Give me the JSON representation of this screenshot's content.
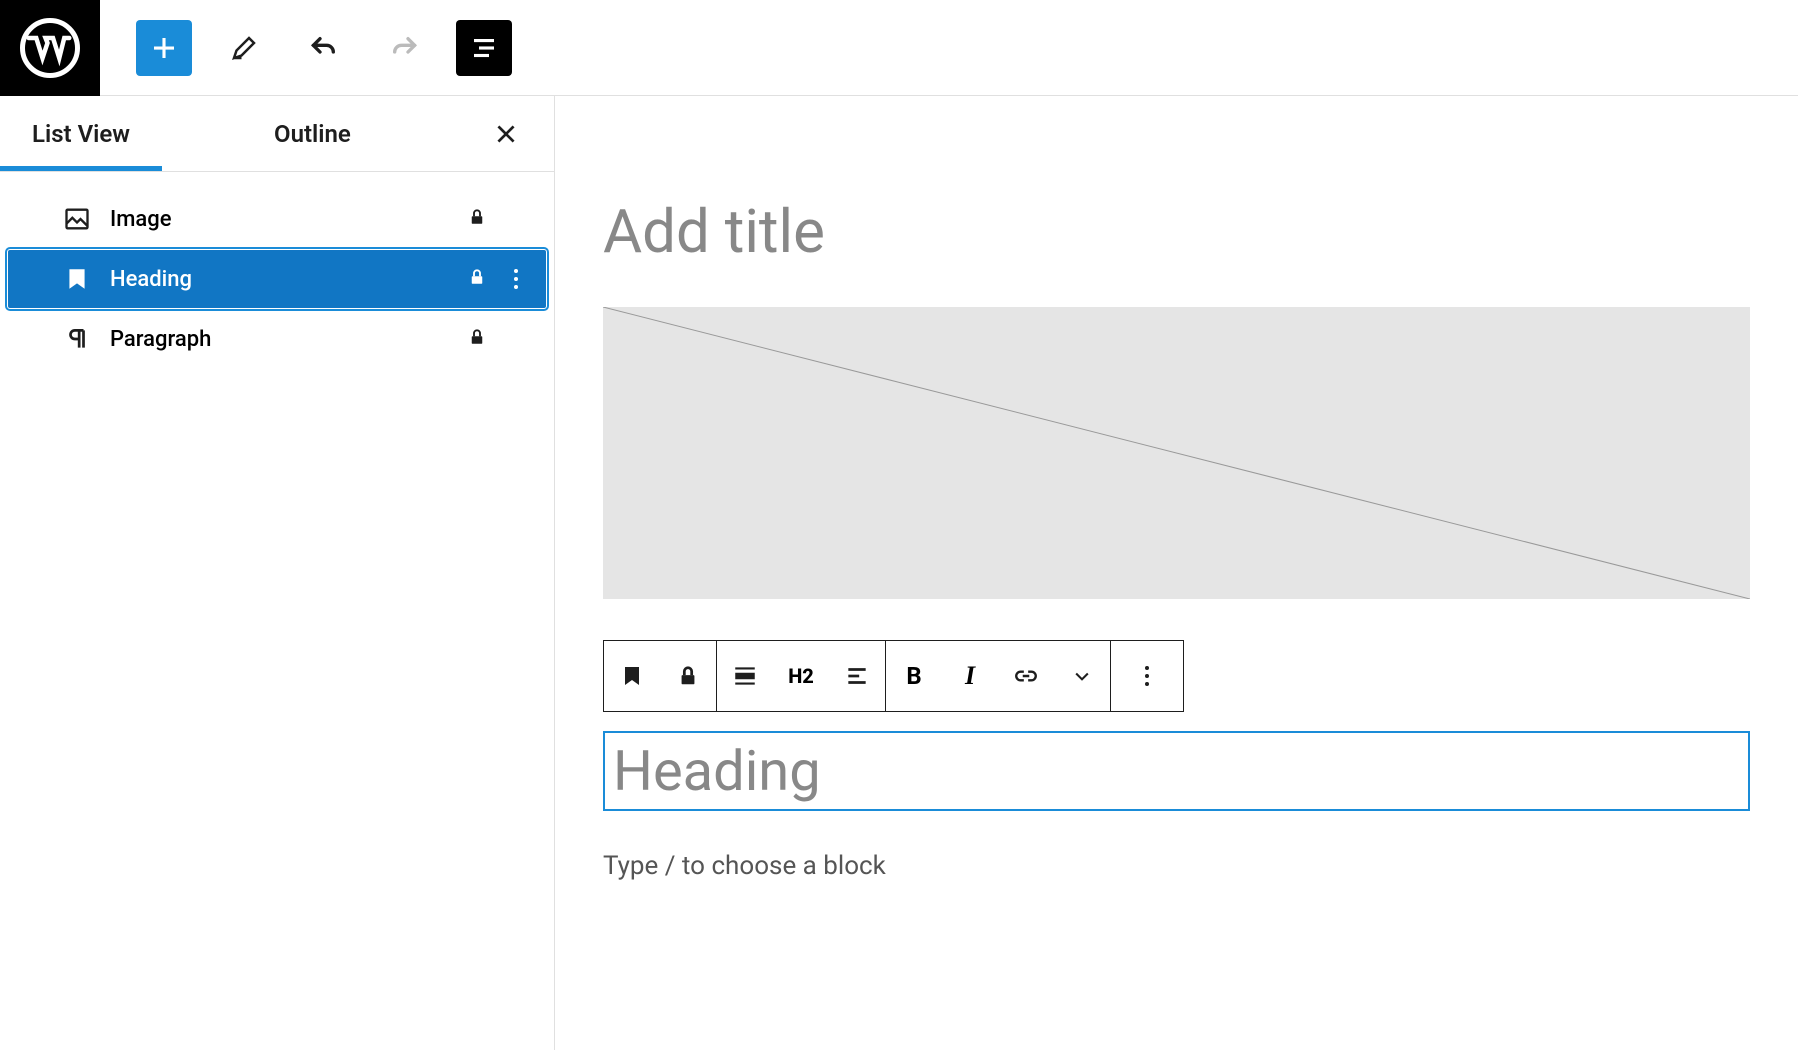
{
  "sidebar": {
    "tabs": {
      "list_view": "List View",
      "outline": "Outline"
    },
    "items": [
      {
        "label": "Image",
        "locked": true
      },
      {
        "label": "Heading",
        "locked": true,
        "selected": true
      },
      {
        "label": "Paragraph",
        "locked": true
      }
    ]
  },
  "editor": {
    "title_placeholder": "Add title",
    "heading_placeholder": "Heading",
    "paragraph_placeholder": "Type / to choose a block",
    "heading_level": "H2"
  }
}
